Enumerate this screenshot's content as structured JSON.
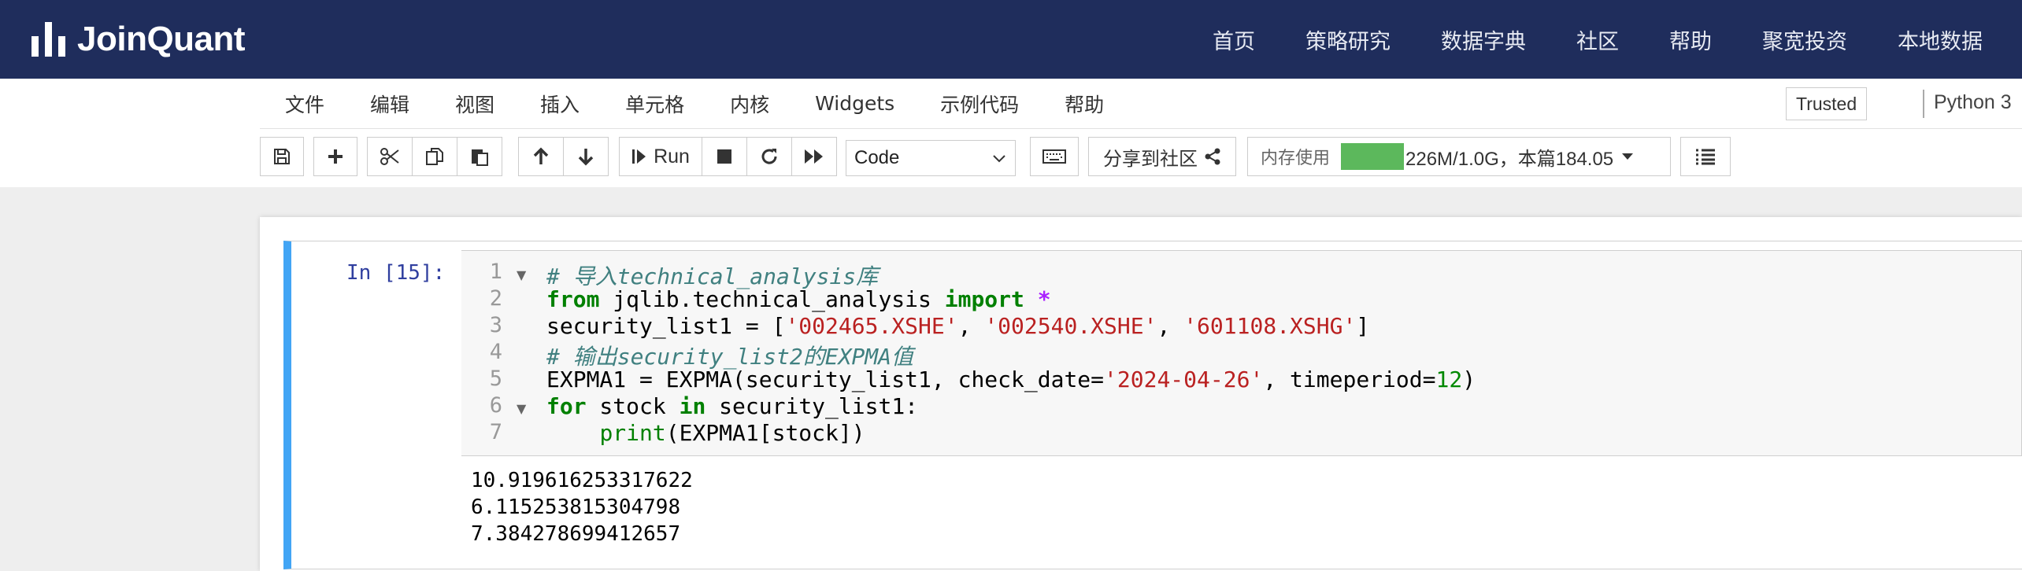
{
  "brand": {
    "name": "JoinQuant"
  },
  "nav": {
    "items": [
      "首页",
      "策略研究",
      "数据字典",
      "社区",
      "帮助",
      "聚宽投资",
      "本地数据"
    ]
  },
  "menubar": {
    "items": [
      "文件",
      "编辑",
      "视图",
      "插入",
      "单元格",
      "内核",
      "Widgets",
      "示例代码",
      "帮助"
    ],
    "trusted": "Trusted",
    "kernel": "Python 3"
  },
  "toolbar": {
    "run_label": "Run",
    "cell_type": "Code",
    "share_label": "分享到社区",
    "memory_label": "内存使用",
    "memory_value": "226M/1.0G，本篇184.05",
    "colors": {
      "memory_bar": "#5cb85c",
      "cell_accent": "#42a5f5",
      "nav_bg": "#1f2d5c"
    }
  },
  "cell": {
    "prompt": "In [15]:",
    "line_numbers": [
      "1",
      "2",
      "3",
      "4",
      "5",
      "6",
      "7"
    ],
    "code": {
      "l1_comment": "# 导入technical_analysis库",
      "l2_from": "from",
      "l2_module": " jqlib.technical_analysis ",
      "l2_import": "import",
      "l2_star": " *",
      "l3_a": "security_list1 = [",
      "l3_s1": "'002465.XSHE'",
      "l3_b": ", ",
      "l3_s2": "'002540.XSHE'",
      "l3_c": ", ",
      "l3_s3": "'601108.XSHG'",
      "l3_d": "]",
      "l4_comment": "# 输出security_list2的EXPMA值",
      "l5_a": "EXPMA1 = EXPMA(security_list1, check_date=",
      "l5_s": "'2024-04-26'",
      "l5_b": ", timeperiod=",
      "l5_n": "12",
      "l5_c": ")",
      "l6_for": "for",
      "l6_a": " stock ",
      "l6_in": "in",
      "l6_b": " security_list1:",
      "l7_indent": "    ",
      "l7_print": "print",
      "l7_rest": "(EXPMA1[stock])"
    },
    "outputs": [
      "10.919616253317622",
      "6.115253815304798",
      "7.384278699412657"
    ]
  }
}
